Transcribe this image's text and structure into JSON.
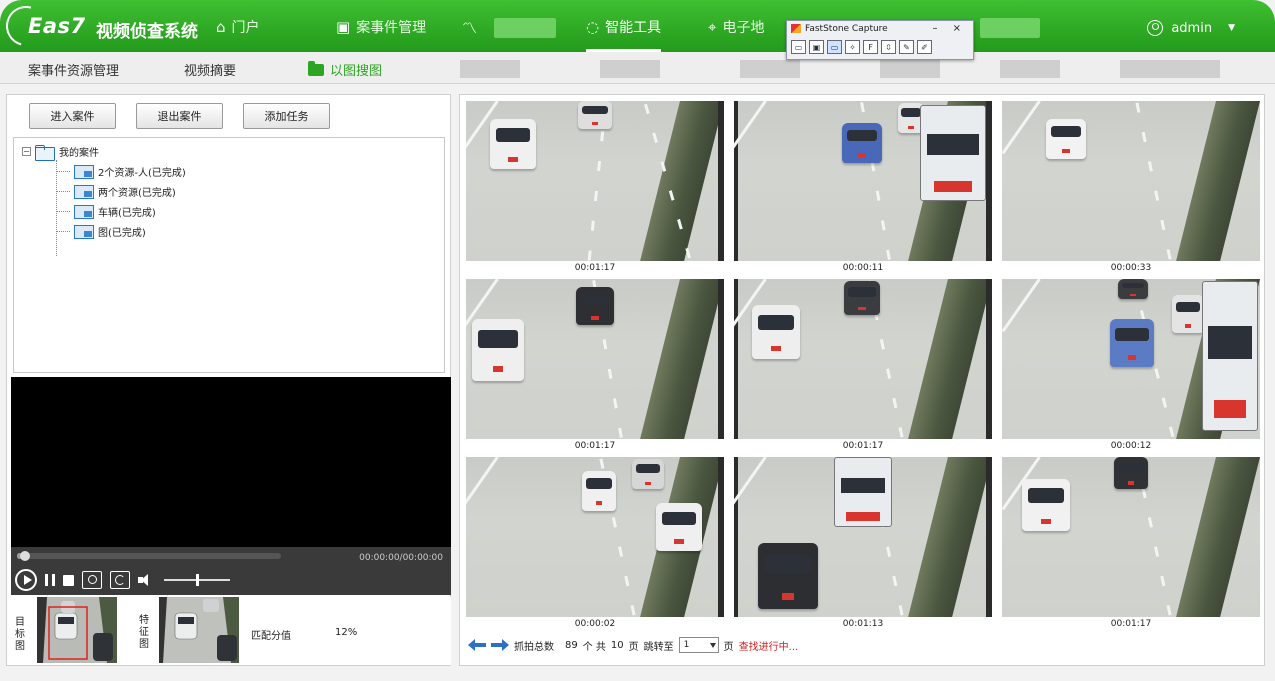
{
  "header": {
    "logo": "Eas7",
    "title": "视频侦查系统",
    "nav": [
      {
        "label": "门户",
        "icon": "home-icon"
      },
      {
        "label": "案事件管理",
        "icon": "film-icon"
      },
      {
        "label": "",
        "icon": "line-chart-icon"
      },
      {
        "label": "智能工具",
        "icon": "swirl-icon"
      },
      {
        "label": "电子地",
        "icon": "map-pin-icon"
      }
    ],
    "user": "admin"
  },
  "faststone": {
    "title": "FastStone Capture",
    "controls": "– ×"
  },
  "subnav": {
    "items": [
      "案事件资源管理",
      "视频摘要",
      "以图搜图"
    ],
    "active": "以图搜图"
  },
  "left": {
    "buttons": [
      "进入案件",
      "退出案件",
      "添加任务"
    ],
    "tree": {
      "root": "我的案件",
      "minus": "−",
      "children": [
        "2个资源-人(已完成)",
        "两个资源(已完成)",
        "车辆(已完成)",
        "图(已完成)"
      ]
    },
    "player": {
      "timecode": "00:00:00/00:00:00",
      "progress": 0.02,
      "volume": 0.5
    },
    "compare": {
      "target_label": "目标图",
      "feature_label": "特征图",
      "match_label": "匹配分值",
      "match_value": "12%"
    }
  },
  "results": {
    "timestamps": [
      "00:01:17",
      "00:00:11",
      "00:00:33",
      "00:01:17",
      "00:01:17",
      "00:00:12",
      "00:00:02",
      "00:01:13",
      "00:01:17"
    ],
    "pager": {
      "total_label": "抓拍总数",
      "total": "89",
      "unit_label": "个 共",
      "pages": "10",
      "page_unit": "页",
      "jump_label": "跳转至",
      "current": "1",
      "page_suffix": "页",
      "status": "查找进行中..."
    }
  },
  "colors": {
    "brand_green": "#2faa25",
    "active_tab": "#2ca523",
    "status_red": "#d11f1f",
    "pager_arrow": "#2c6fc9"
  }
}
